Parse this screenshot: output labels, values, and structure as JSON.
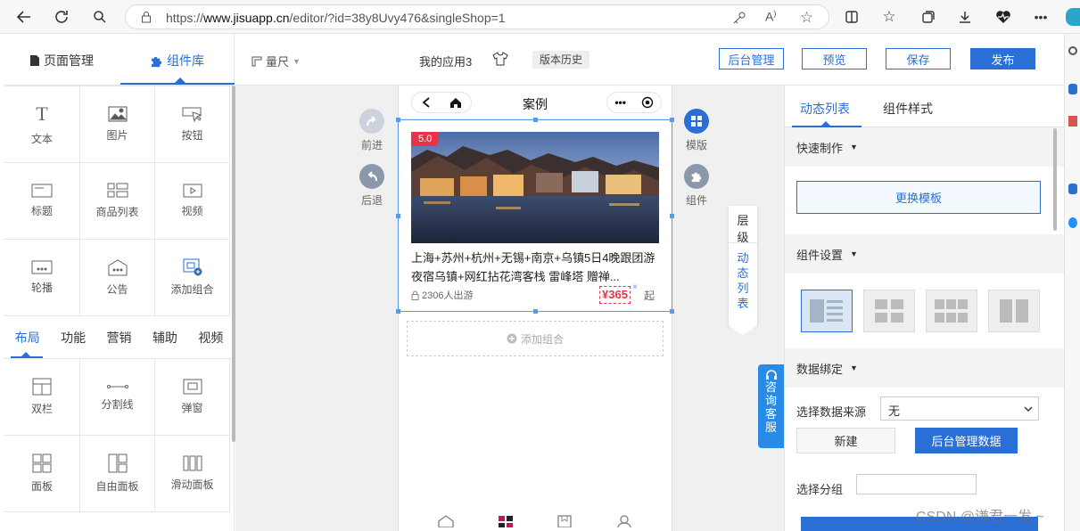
{
  "browser": {
    "url_prefix": "https://",
    "url_domain": "www.jisuapp.cn",
    "url_path": "/editor/?id=38y8Uvy476&singleShop=1"
  },
  "left": {
    "tabs": [
      "页面管理",
      "组件库"
    ],
    "components": [
      "文本",
      "图片",
      "按钮",
      "标题",
      "商品列表",
      "视频",
      "轮播",
      "公告",
      "添加组合"
    ],
    "categories": [
      "布局",
      "功能",
      "营销",
      "辅助",
      "视频"
    ],
    "layout_items": [
      "双栏",
      "分割线",
      "弹窗",
      "面板",
      "自由面板",
      "滑动面板"
    ]
  },
  "toolbar": {
    "ruler": "量尺",
    "app_name": "我的应用3",
    "history": "版本历史",
    "admin": "后台管理",
    "preview": "预览",
    "save": "保存",
    "publish": "发布"
  },
  "canvas": {
    "forward": "前进",
    "back": "后退",
    "template": "模版",
    "component": "组件",
    "layer_tab": [
      "层",
      "级"
    ],
    "dyn_tab": [
      "动",
      "态",
      "列",
      "表"
    ],
    "service": [
      "咨",
      "询",
      "客",
      "服"
    ]
  },
  "phone": {
    "title": "案例",
    "rating": "5.0",
    "product_title": "上海+苏州+杭州+无锡+南京+乌镇5日4晚跟团游夜宿乌镇+网红拈花湾客栈 雷峰塔 赠禅...",
    "sales": "2306人出游",
    "price": "¥365",
    "price_suffix": "起",
    "add_group": "添加组合"
  },
  "right": {
    "tabs": [
      "动态列表",
      "组件样式"
    ],
    "quick": "快速制作",
    "change_template": "更换模板",
    "component_settings": "组件设置",
    "data_binding": "数据绑定",
    "source_label": "选择数据来源",
    "source_value": "无",
    "new_btn": "新建",
    "admin_data_btn": "后台管理数据",
    "category_label": "选择分组"
  },
  "watermark": "CSDN @谦君一发.~",
  "colors": {
    "accent": "#2a6fd6",
    "price": "#e8334a",
    "badge": "#e8334a"
  }
}
